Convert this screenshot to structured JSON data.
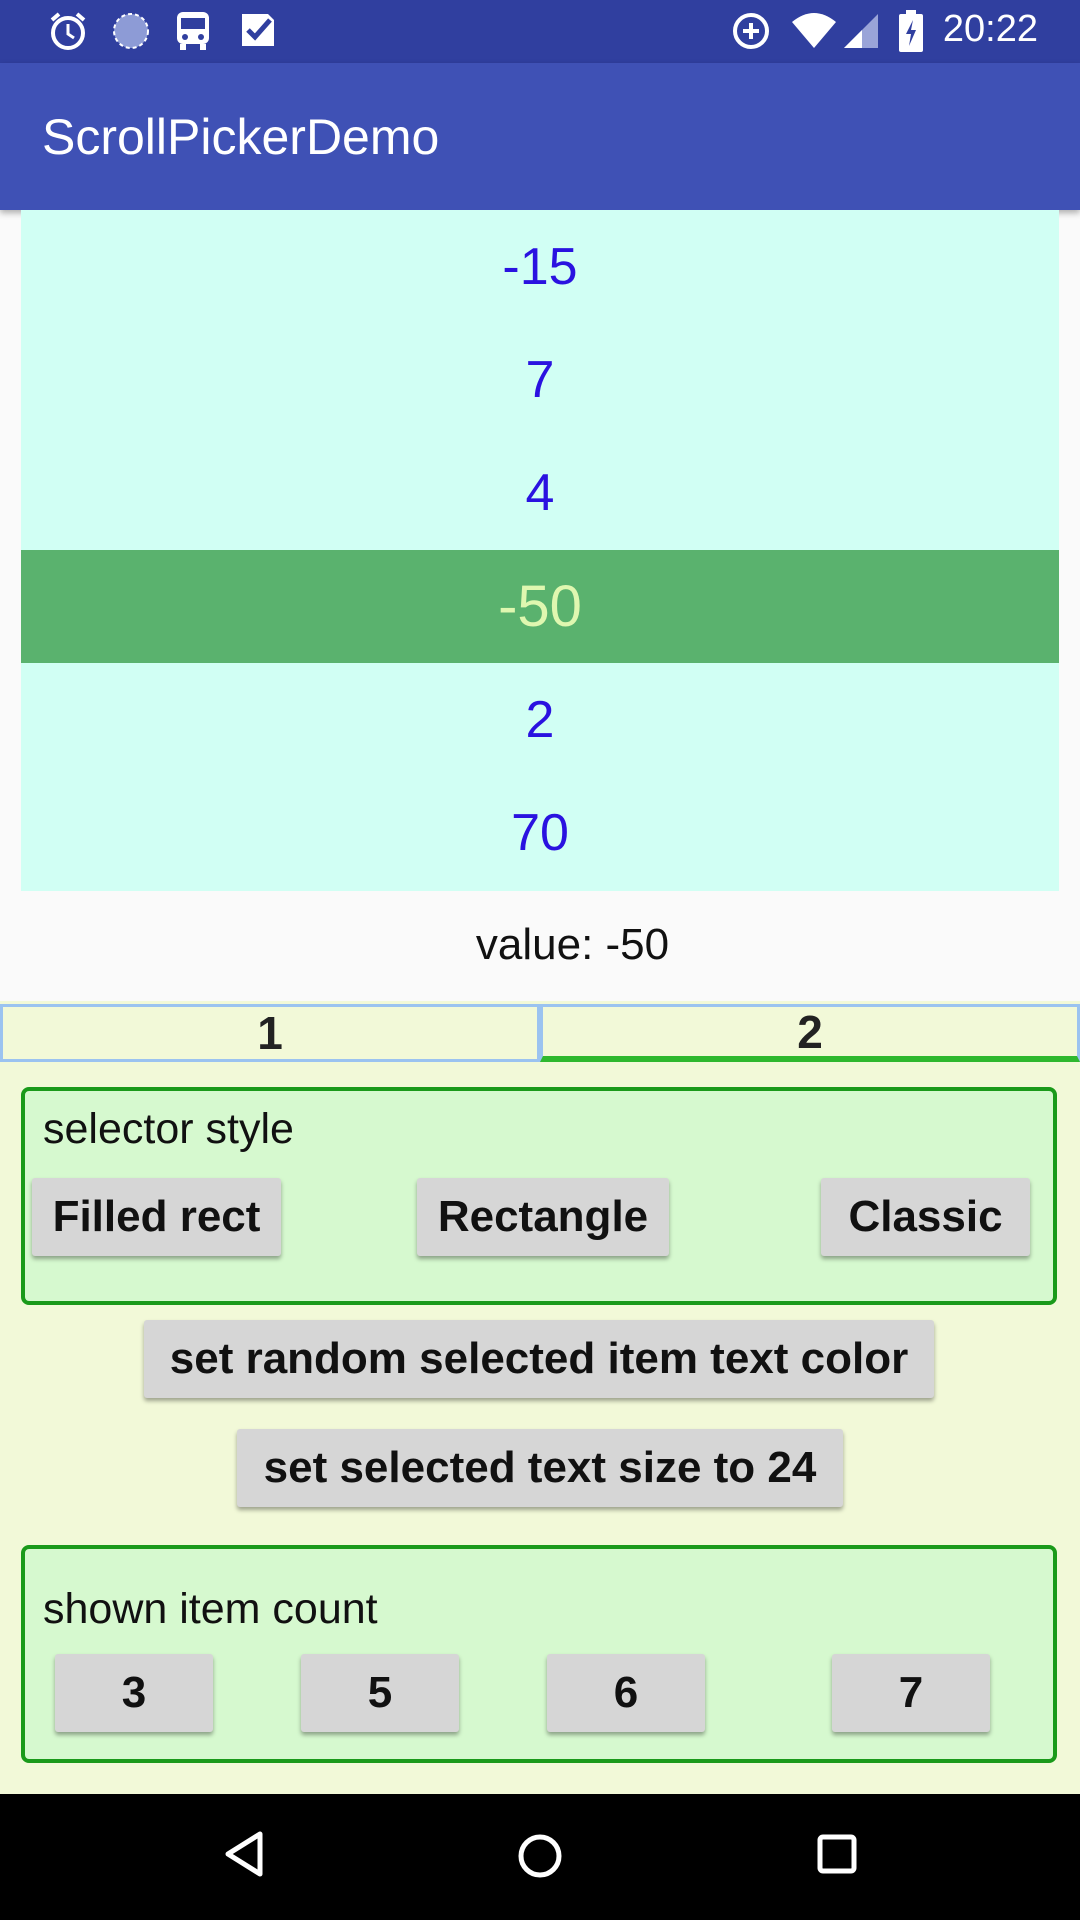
{
  "status_bar": {
    "time": "20:22",
    "left_icons": [
      "alarm-icon",
      "sync-icon",
      "bus-icon",
      "task-icon"
    ],
    "right_icons": [
      "data-saver-icon",
      "wifi-icon",
      "signal-icon",
      "battery-icon"
    ]
  },
  "app_bar": {
    "title": "ScrollPickerDemo"
  },
  "picker": {
    "items": [
      "-15",
      "7",
      "4",
      "-50",
      "2",
      "70"
    ],
    "selected_index": 3,
    "colors": {
      "background": "#d1fff4",
      "text": "#2a12e0",
      "selected_bg": "#5ab26e",
      "selected_text": "#dff7b0"
    }
  },
  "value_label": "value: -50",
  "tabs": {
    "items": [
      "1",
      "2"
    ],
    "active_index": 1
  },
  "selector_style": {
    "label": "selector style",
    "buttons": [
      "Filled rect",
      "Rectangle",
      "Classic"
    ]
  },
  "actions": {
    "random_color": "set random selected item text color",
    "text_size": "set selected text size to 24"
  },
  "item_count": {
    "label": "shown item count",
    "buttons": [
      "3",
      "5",
      "6",
      "7"
    ]
  },
  "nav_bar": {
    "icons": [
      "back-icon",
      "home-icon",
      "recents-icon"
    ]
  }
}
